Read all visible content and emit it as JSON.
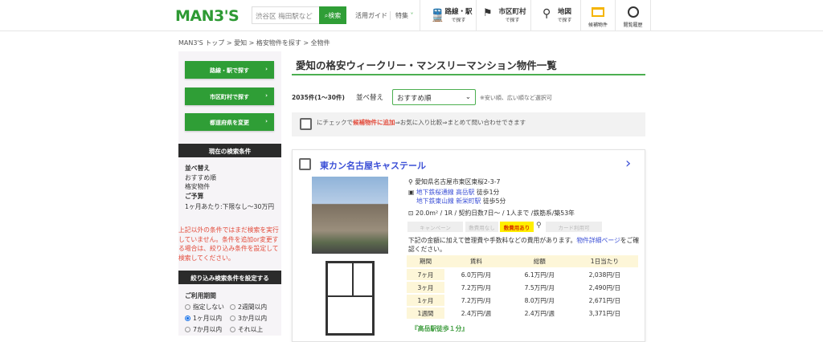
{
  "header": {
    "logo": "MAN3'S",
    "search_placeholder": "渋谷区 梅田駅など",
    "search_button": "検索",
    "guide": "活用ガイド",
    "feature": "特集",
    "nav": [
      {
        "title": "路線・駅",
        "sub": "で探す",
        "icon": "train-icon"
      },
      {
        "title": "市区町村",
        "sub": "で探す",
        "icon": "map-area-icon"
      },
      {
        "title": "地図",
        "sub": "で探す",
        "icon": "pin-icon"
      },
      {
        "title": "",
        "sub": "候補物件",
        "icon": "folder-icon"
      },
      {
        "title": "",
        "sub": "閲覧履歴",
        "icon": "clock-icon"
      }
    ]
  },
  "breadcrumb": [
    "MAN3'S トップ",
    "愛知",
    "格安物件を探す",
    "全物件"
  ],
  "sidebar": {
    "buttons": [
      "路線・駅で探す",
      "市区町村で探す",
      "都道府県を変更"
    ],
    "current_title": "現在の検索条件",
    "sort_label": "並べ替え",
    "sort_value": "おすすめ順",
    "type_value": "格安物件",
    "budget_label": "ご予算",
    "budget_value": "1ヶ月あたり:下限なし〜30万円",
    "notice": "上記以外の条件ではまだ検索を実行していません。条件を追加or変更する場合は、絞り込み条件を設定して検索してください。",
    "refine_title": "絞り込み検索条件を設定する",
    "period_label": "ご利用期間",
    "periods": [
      {
        "label": "指定しない",
        "checked": false
      },
      {
        "label": "2週間以内",
        "checked": false
      },
      {
        "label": "1ヶ月以内",
        "checked": true
      },
      {
        "label": "3か月以内",
        "checked": false
      },
      {
        "label": "7か月以内",
        "checked": false
      },
      {
        "label": "それ以上",
        "checked": false
      }
    ]
  },
  "main": {
    "title": "愛知の格安ウィークリー・マンスリーマンション物件一覧",
    "count": "2035件(1〜30件)",
    "sort_label": "並べ替え",
    "sort_value": "おすすめ順",
    "sort_note": "※安い順、広い順など選択可",
    "check_pre": "にチェックで",
    "check_red": "候補物件に追加",
    "check_post": "⇒お気に入り比較⇒まとめて問い合わせできます"
  },
  "property": {
    "name": "東カン名古屋キャステール",
    "address": "愛知県名古屋市東区東桜2-3-7",
    "lines": [
      {
        "line": "地下鉄桜通線",
        "station": "高岳駅",
        "walk": "徒歩1分"
      },
      {
        "line": "地下鉄東山線",
        "station": "新栄町駅",
        "walk": "徒歩5分"
      }
    ],
    "specs": "20.0m² / 1R / 契約日数7日〜 / 1人まで /鉄筋系/築53年",
    "tags": [
      "キャンペーン",
      "敷費用なし",
      "敷費用あり",
      "カード利用可"
    ],
    "note_pre": "下記の金額に加えて管理費や手数料などの費用があります。",
    "note_link": "物件詳細ページ",
    "note_post": "をご確認ください。",
    "table_headers": [
      "期間",
      "賃料",
      "総額",
      "1日当たり"
    ],
    "rows": [
      [
        "7ヶ月",
        "6.0万円/月",
        "6.1万円/月",
        "2,038円/日"
      ],
      [
        "3ヶ月",
        "7.2万円/月",
        "7.5万円/月",
        "2,490円/日"
      ],
      [
        "1ヶ月",
        "7.2万円/月",
        "8.0万円/月",
        "2,671円/日"
      ],
      [
        "1週間",
        "2.4万円/週",
        "2.4万円/週",
        "3,371円/日"
      ]
    ],
    "catch": "『高岳駅徒歩１分』"
  }
}
